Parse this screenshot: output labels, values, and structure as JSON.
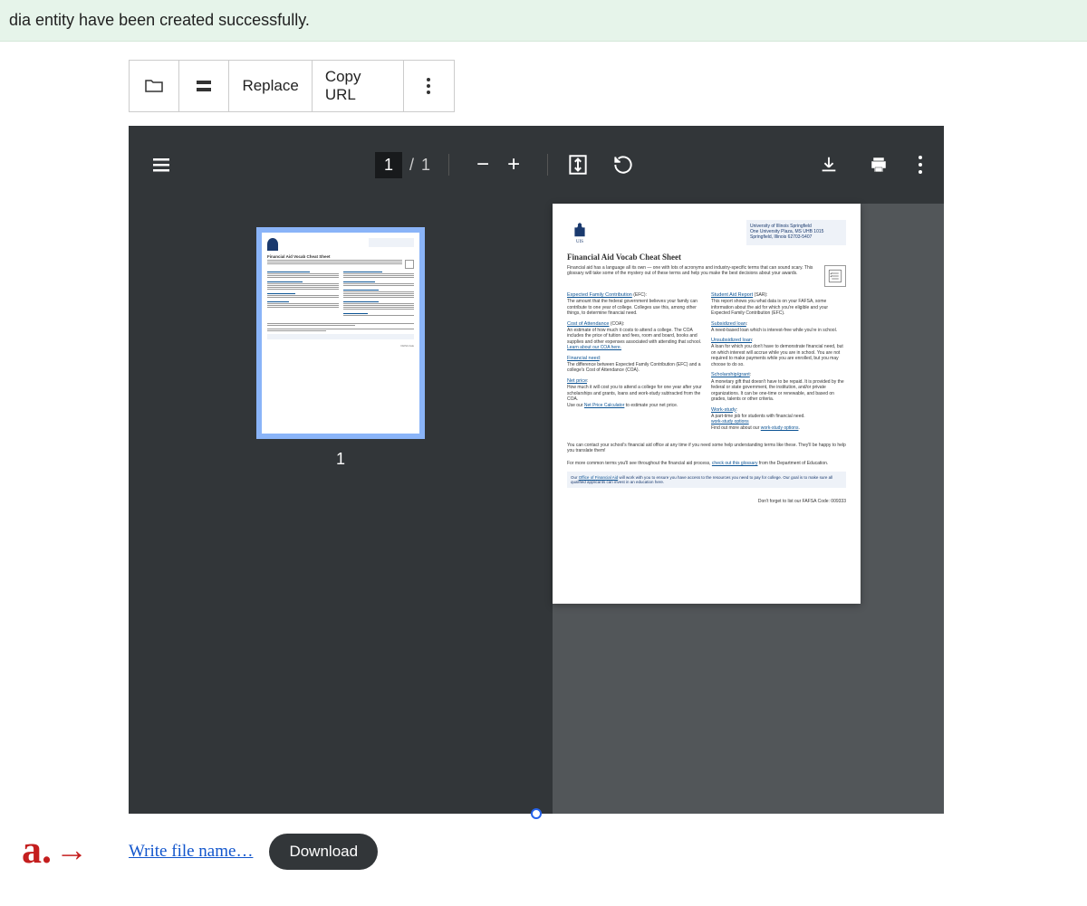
{
  "status_message": "dia entity have been created successfully.",
  "toolbar": {
    "replace_label": "Replace",
    "copy_url_label": "Copy URL"
  },
  "pdf": {
    "current_page": "1",
    "total_pages": "1",
    "thumb_num": "1"
  },
  "doc": {
    "address_line1": "University of Illinois Springfield",
    "address_line2": "One University Plaza, MS UHB 1015",
    "address_line3": "Springfield, Illinois 62703-5407",
    "title": "Financial Aid Vocab Cheat Sheet",
    "intro": "Financial aid has a language all its own — one with lots of acronyms and industry-specific terms that can sound scary. This glossary will take some of the mystery out of these terms and help you make the best decisions about your awards.",
    "terms_left": [
      {
        "term": "Expected Family Contribution",
        "abbr": " (EFC):",
        "def": "The amount that the federal government believes your family can contribute to one year of college. Colleges use this, among other things, to determine financial need."
      },
      {
        "term": "Cost of Attendance",
        "abbr": " (COA):",
        "def": "An estimate of how much it costs to attend a college. The COA includes the price of tuition and fees, room and board, books and supplies and other expenses associated with attending that school.",
        "link": "Learn about our COA here."
      },
      {
        "term": "Financial need",
        "abbr": ":",
        "def": "The difference between Expected Family Contribution (EFC) and a college's Cost of Attendance (COA)."
      },
      {
        "term": "Net price",
        "abbr": ":",
        "def": "How much it will cost you to attend a college for one year after your scholarships and grants, loans and work-study subtracted from the COA.",
        "link2_pre": "Use our ",
        "link2": "Net Price Calculator",
        "link2_post": " to estimate your net price."
      }
    ],
    "terms_right": [
      {
        "term": "Student Aid Report",
        "abbr": " (SAR):",
        "def": "This report shows you what data is on your FAFSA, some information about the aid for which you're eligible and your Expected Family Contribution (EFC)."
      },
      {
        "term": "Subsidized loan",
        "abbr": ":",
        "def": "A need-based loan which is interest-free while you're in school."
      },
      {
        "term": "Unsubsidized loan",
        "abbr": ":",
        "def": "A loan for which you don't have to demonstrate financial need, but on which interest will accrue while you are in school. You are not required to make payments while you are enrolled, but you may choose to do so."
      },
      {
        "term": "Scholarship/grant",
        "abbr": ":",
        "def": "A monetary gift that doesn't have to be repaid. It is provided by the federal or state government, the institution, and/or private organizations. It can be one-time or renewable, and based on grades, talents or other criteria."
      },
      {
        "term": "Work-study",
        "abbr": ":",
        "def": "A part-time job for students with financial need.",
        "link_pre": "Find out more about our ",
        "link": "work-study options",
        "link_post": "."
      }
    ],
    "footer1": "You can contact your school's financial aid office at any time if you need some help understanding terms like these. They'll be happy to help you translate them!",
    "footer2_pre": "For more common terms you'll see throughout the financial aid process, ",
    "footer2_link": "check out this glossary",
    "footer2_post": " from the Department of Education.",
    "note_pre": "Our ",
    "note_link": "Office of Financial Aid",
    "note_post": " will work with you to ensure you have access to the resources you need to pay for college. Our goal is to make sure all qualified applicants can invest in an education here.",
    "fafsa": "Don't forget to list our FAFSA Code: 009333"
  },
  "bottom": {
    "annotation": "a.",
    "file_placeholder": "Write file name…",
    "download_label": "Download"
  }
}
